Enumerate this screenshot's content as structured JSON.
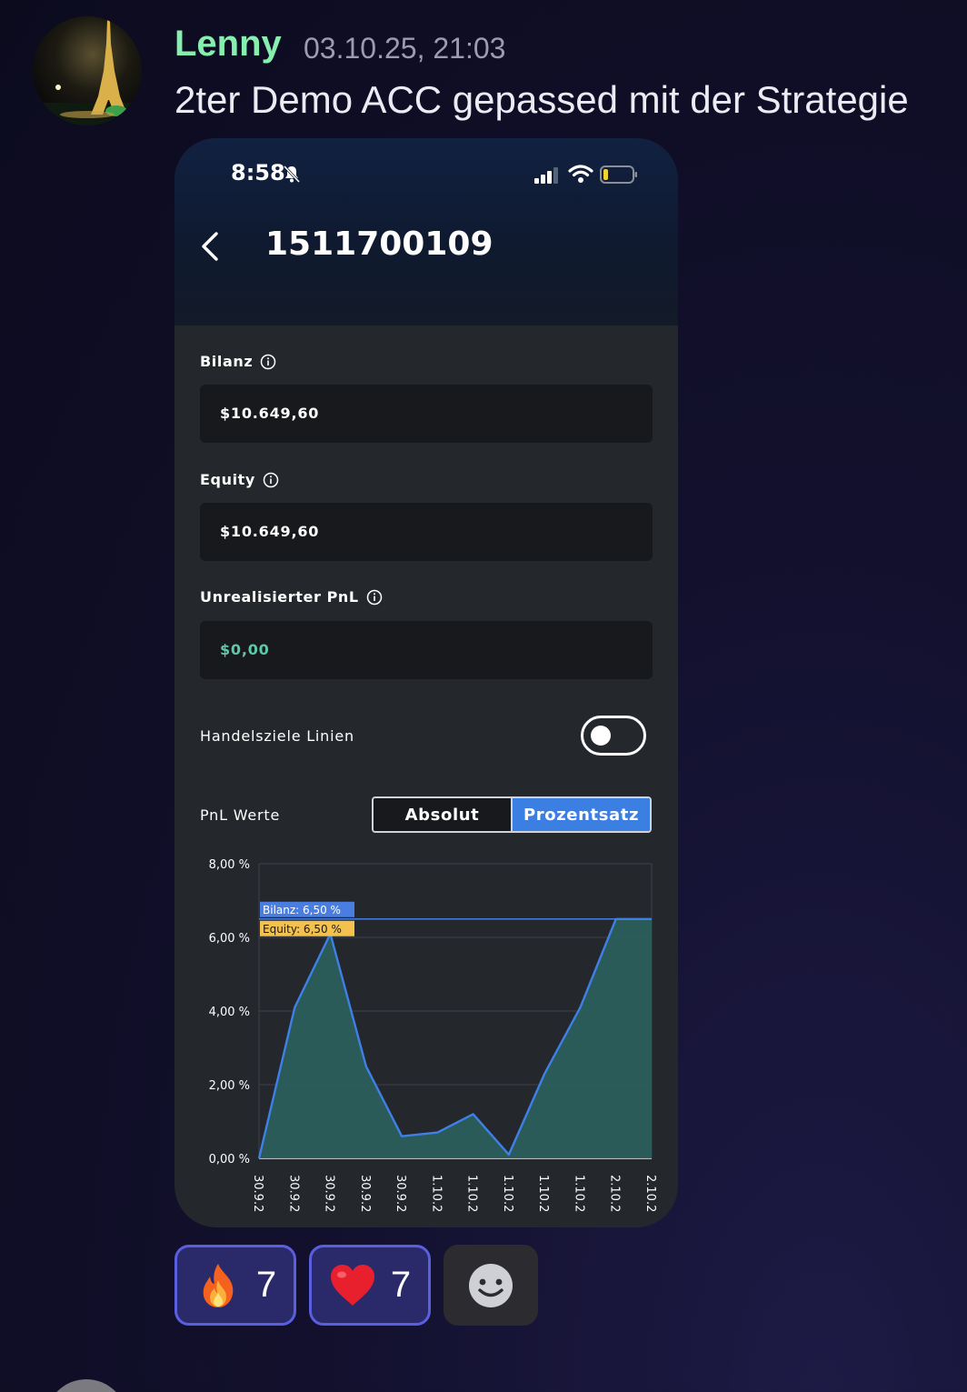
{
  "message": {
    "username": "Lenny",
    "timestamp": "03.10.25, 21:03",
    "text": "2ter Demo ACC gepassed mit der Strategie"
  },
  "phone": {
    "status_time": "8:58",
    "account_id": "1511700109",
    "fields": [
      {
        "label": "Bilanz",
        "value": "$10.649,60"
      },
      {
        "label": "Equity",
        "value": "$10.649,60"
      },
      {
        "label": "Unrealisierter PnL",
        "value": "$0,00"
      }
    ],
    "toggle_label": "Handelsziele Linien",
    "toggle_on": false,
    "pnl_label": "PnL Werte",
    "segments": [
      "Absolut",
      "Prozentsatz"
    ],
    "selected_segment": "Prozentsatz",
    "colors": {
      "accent": "#3c7fe3",
      "positive": "#5fc9a6",
      "username": "#86efb0"
    }
  },
  "chart_data": {
    "type": "area",
    "y_tick_labels": [
      "8,00 %",
      "6,00 %",
      "4,00 %",
      "2,00 %",
      "0,00 %"
    ],
    "ylim": [
      0,
      8
    ],
    "x_tick_labels": [
      "30.9.2",
      "30.9.2",
      "30.9.2",
      "30.9.2",
      "30.9.2",
      "1.10.2",
      "1.10.2",
      "1.10.2",
      "1.10.2",
      "1.10.2",
      "2.10.2",
      "2.10.2"
    ],
    "series": [
      {
        "name": "Bilanz",
        "values": [
          0,
          4.1,
          6.1,
          2.5,
          0.6,
          0.7,
          1.2,
          0.1,
          2.3,
          4.1,
          6.5,
          6.5
        ]
      }
    ],
    "annotations": [
      {
        "label": "Bilanz: 6,50 %",
        "color": "#4a7de0"
      },
      {
        "label": "Equity: 6,50 %",
        "color": "#f2c14e"
      }
    ],
    "reference_value": 6.5,
    "grid": true
  },
  "reactions": [
    {
      "emoji": "fire-emoji",
      "count": "7"
    },
    {
      "emoji": "heart-emoji",
      "count": "7"
    }
  ]
}
